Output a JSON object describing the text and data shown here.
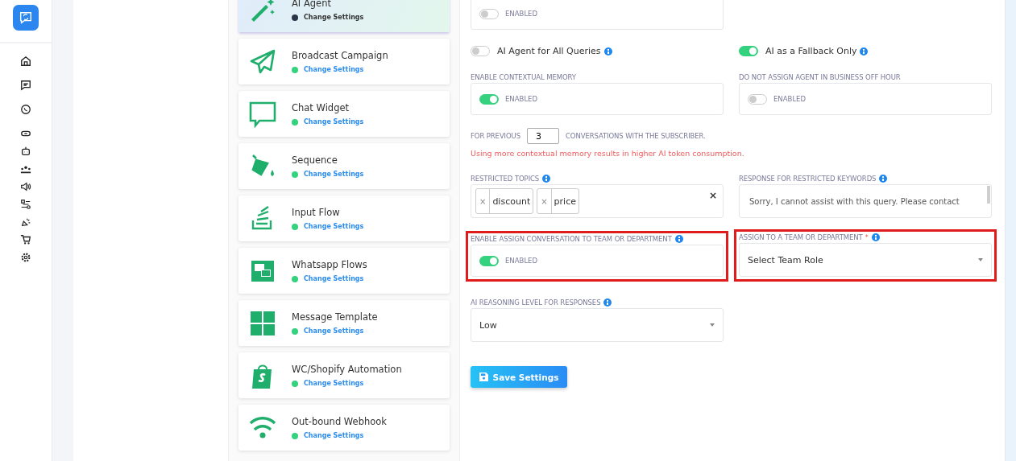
{
  "modules": [
    {
      "name": "AI Agent",
      "link": "Change Settings",
      "selected": true
    },
    {
      "name": "Broadcast Campaign",
      "link": "Change Settings",
      "selected": false
    },
    {
      "name": "Chat Widget",
      "link": "Change Settings",
      "selected": false
    },
    {
      "name": "Sequence",
      "link": "Change Settings",
      "selected": false
    },
    {
      "name": "Input Flow",
      "link": "Change Settings",
      "selected": false
    },
    {
      "name": "Whatsapp Flows",
      "link": "Change Settings",
      "selected": false
    },
    {
      "name": "Message Template",
      "link": "Change Settings",
      "selected": false
    },
    {
      "name": "WC/Shopify Automation",
      "link": "Change Settings",
      "selected": false
    },
    {
      "name": "Out-bound Webhook",
      "link": "Change Settings",
      "selected": false
    }
  ],
  "top_toggle": {
    "label": "ENABLED",
    "on": false
  },
  "mode_toggles": [
    {
      "label": "AI Agent for All Queries",
      "on": false
    },
    {
      "label": "AI as a Fallback Only",
      "on": true
    }
  ],
  "contextual_memory": {
    "label": "ENABLE CONTEXTUAL MEMORY",
    "toggle": {
      "label": "ENABLED",
      "on": true
    }
  },
  "business_off_hour": {
    "label": "DO NOT ASSIGN AGENT IN BUSINESS OFF HOUR",
    "toggle": {
      "label": "ENABLED",
      "on": false
    }
  },
  "memory": {
    "prefix": "FOR PREVIOUS",
    "value": "3",
    "suffix": "CONVERSATIONS WITH THE SUBSCRIBER.",
    "warning": "Using more contextual memory results in higher AI token consumption."
  },
  "restricted_topics": {
    "label": "RESTRICTED TOPICS",
    "tags": [
      {
        "text": "discount",
        "remove": "×"
      },
      {
        "text": "price",
        "remove": "×"
      }
    ],
    "clear": "×"
  },
  "restricted_response": {
    "label": "RESPONSE FOR RESTRICTED KEYWORDS",
    "value": "Sorry, I cannot assist with this query. Please contact"
  },
  "assign_conversation": {
    "label": "ENABLE ASSIGN CONVERSATION TO TEAM OR DEPARTMENT",
    "highlighted": true,
    "toggle": {
      "label": "ENABLED",
      "on": true
    }
  },
  "assign_team": {
    "label": "ASSIGN TO A TEAM OR DEPARTMENT",
    "required": "*",
    "value": "Select Team Role",
    "highlighted": true
  },
  "reasoning": {
    "label": "AI REASONING LEVEL FOR RESPONSES",
    "value": "Low"
  },
  "save_button": "Save Settings"
}
